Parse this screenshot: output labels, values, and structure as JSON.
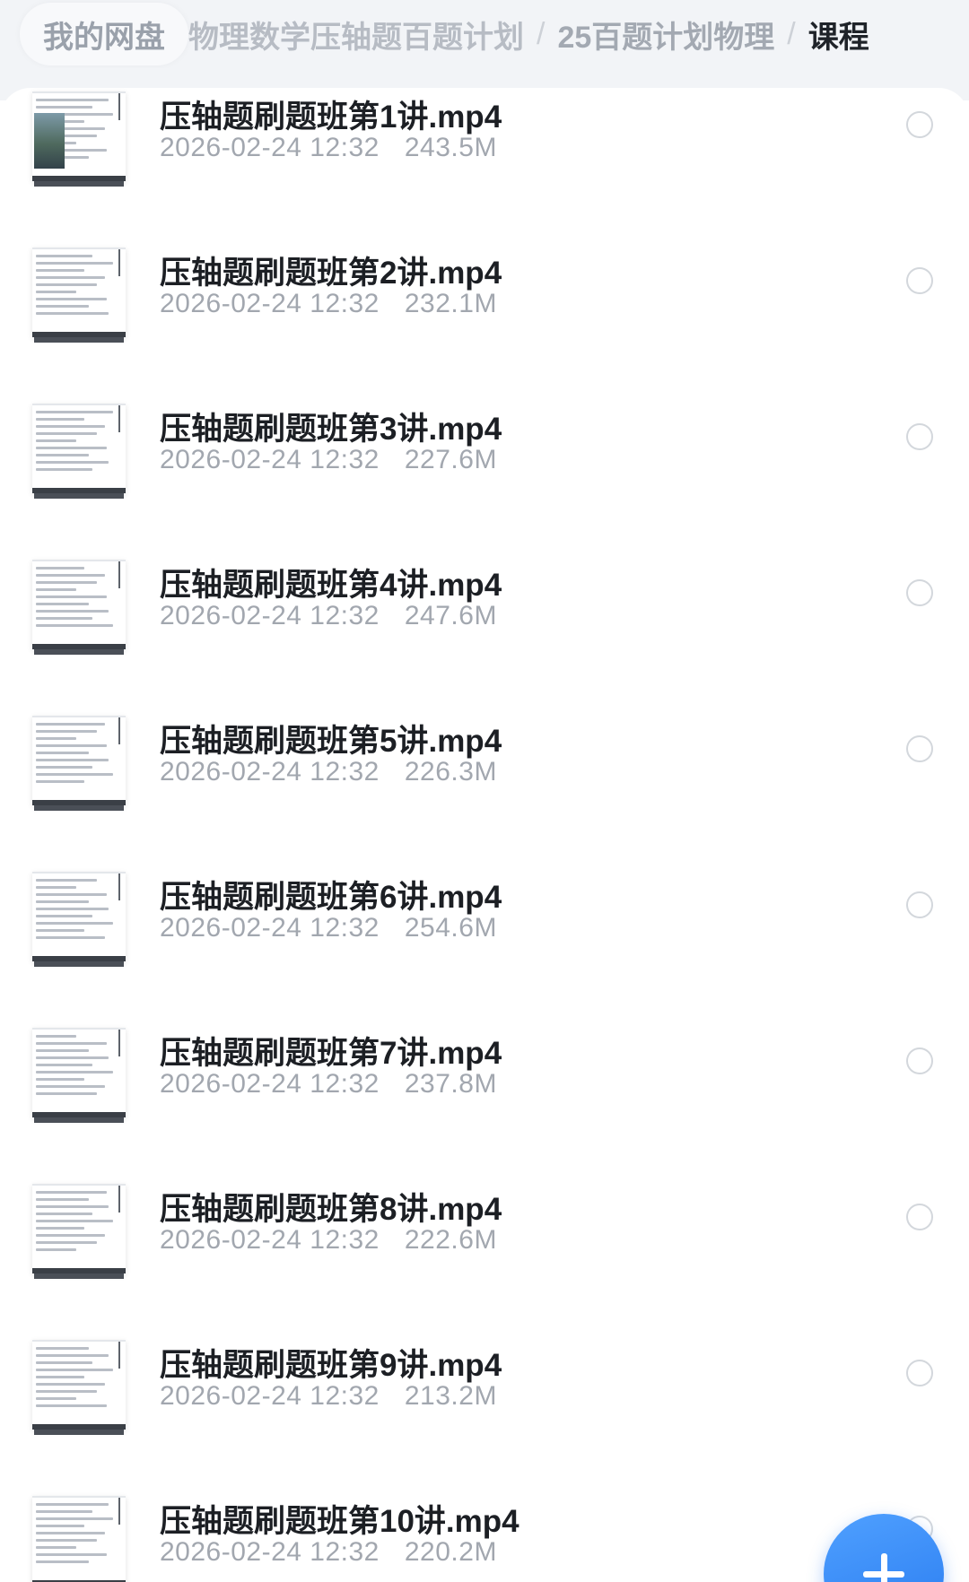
{
  "breadcrumb": {
    "root": "我的网盘",
    "items": [
      "物理数学压轴题百题计划",
      "25百题计划物理"
    ],
    "current": "课程"
  },
  "files": [
    {
      "name": "压轴题刷题班第1讲.mp4",
      "date": "2026-02-24 12:32",
      "size": "243.5M"
    },
    {
      "name": "压轴题刷题班第2讲.mp4",
      "date": "2026-02-24 12:32",
      "size": "232.1M"
    },
    {
      "name": "压轴题刷题班第3讲.mp4",
      "date": "2026-02-24 12:32",
      "size": "227.6M"
    },
    {
      "name": "压轴题刷题班第4讲.mp4",
      "date": "2026-02-24 12:32",
      "size": "247.6M"
    },
    {
      "name": "压轴题刷题班第5讲.mp4",
      "date": "2026-02-24 12:32",
      "size": "226.3M"
    },
    {
      "name": "压轴题刷题班第6讲.mp4",
      "date": "2026-02-24 12:32",
      "size": "254.6M"
    },
    {
      "name": "压轴题刷题班第7讲.mp4",
      "date": "2026-02-24 12:32",
      "size": "237.8M"
    },
    {
      "name": "压轴题刷题班第8讲.mp4",
      "date": "2026-02-24 12:32",
      "size": "222.6M"
    },
    {
      "name": "压轴题刷题班第9讲.mp4",
      "date": "2026-02-24 12:32",
      "size": "213.2M"
    },
    {
      "name": "压轴题刷题班第10讲.mp4",
      "date": "2026-02-24 12:32",
      "size": "220.2M"
    }
  ],
  "colors": {
    "accent": "#2a7cf0",
    "title_text": "#1c1f24",
    "meta_text": "#a2a7af"
  },
  "icons": {
    "select": "radio-circle-icon",
    "add": "plus-icon",
    "file_preview": "video-thumbnail"
  }
}
